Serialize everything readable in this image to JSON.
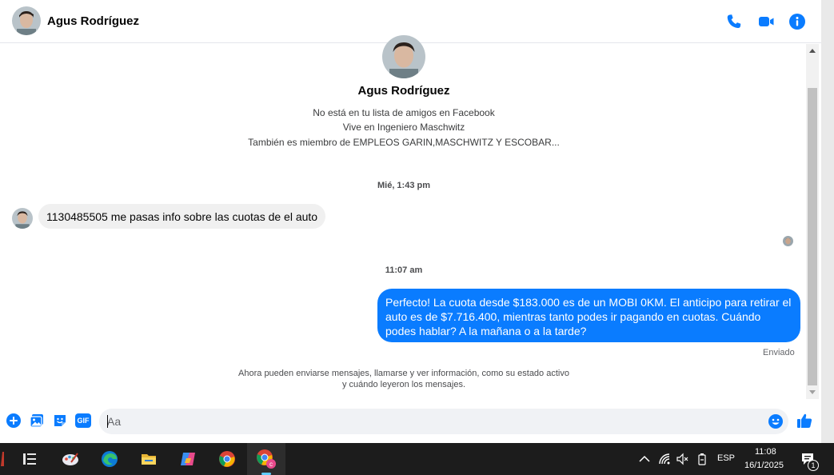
{
  "header": {
    "contact_name": "Agus Rodríguez",
    "icons": [
      "phone-icon",
      "video-camera-icon",
      "info-icon"
    ],
    "accent_color": "#0a7cff"
  },
  "profile": {
    "name": "Agus Rodríguez",
    "info_lines": [
      "No está en tu lista de amigos en Facebook",
      "Vive en Ingeniero Maschwitz",
      "También es miembro de EMPLEOS GARIN,MASCHWITZ Y ESCOBAR..."
    ]
  },
  "conversation": {
    "timestamp_1": "Mié, 1:43 pm",
    "incoming_message": "1130485505 me pasas info sobre las cuotas de el auto",
    "timestamp_2": "11:07 am",
    "outgoing_message": "Perfecto! La cuota desde $183.000 es de un MOBI 0KM. El anticipo para retirar el auto es de $7.716.400, mientras tanto podes ir pagando en cuotas. Cuándo podes hablar? A la mañana o a la tarde?",
    "outgoing_status": "Enviado",
    "notice_line_1": "Ahora pueden enviarse mensajes, llamarse y ver información, como su estado activo",
    "notice_line_2": "y cuándo leyeron los mensajes."
  },
  "composer": {
    "placeholder": "Aa",
    "value": "",
    "icons": [
      "plus-icon",
      "image-icon",
      "sticker-icon",
      "gif-icon",
      "emoji-icon",
      "like-icon"
    ],
    "gif_label": "GIF"
  },
  "taskbar": {
    "apps": [
      "task-view-icon",
      "paint-app-icon",
      "edge-browser-icon",
      "file-explorer-icon",
      "copilot-icon",
      "chrome-icon",
      "chrome-profile-icon"
    ],
    "language": "ESP",
    "time": "11:08",
    "date": "16/1/2025",
    "notification_count": "1"
  }
}
